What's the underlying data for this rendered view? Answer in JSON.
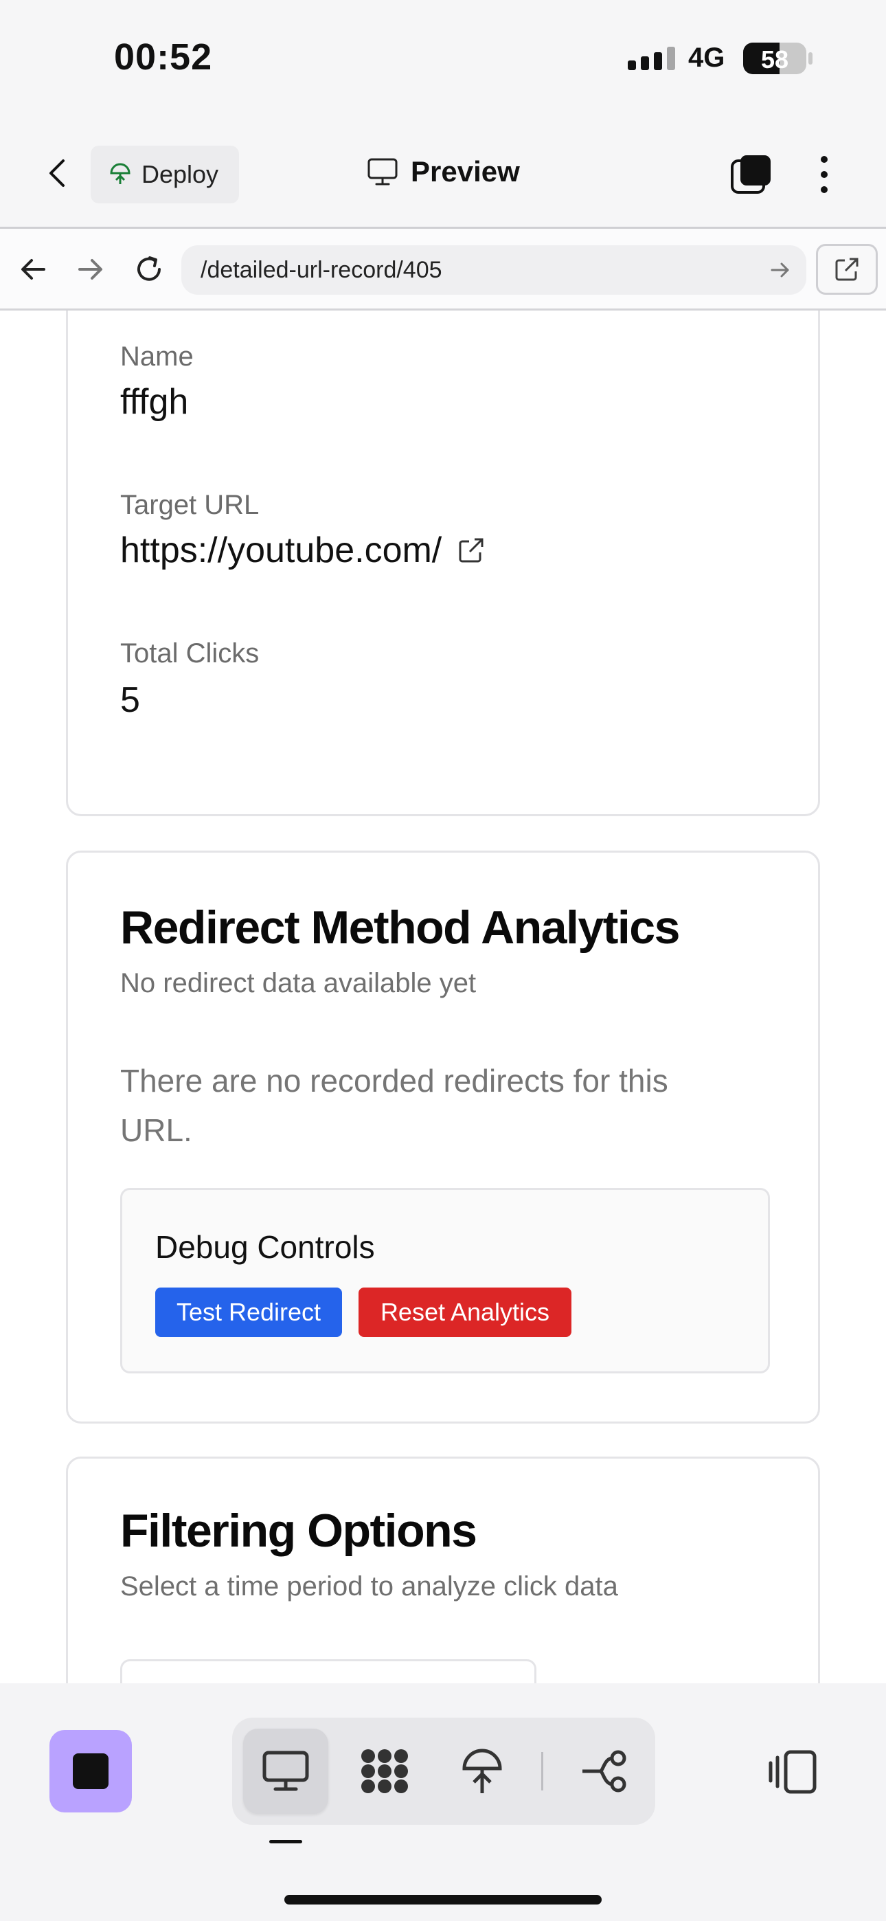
{
  "status_bar": {
    "time": "00:52",
    "network": "4G",
    "battery": "58",
    "battery_level": 0.58
  },
  "app_header": {
    "deploy_label": "Deploy",
    "preview_label": "Preview"
  },
  "browser": {
    "url": "/detailed-url-record/405"
  },
  "details_card": {
    "name_label": "Name",
    "name_value": "fffgh",
    "target_url_label": "Target URL",
    "target_url_value": "https://youtube.com/",
    "total_clicks_label": "Total Clicks",
    "total_clicks_value": "5"
  },
  "redirect_card": {
    "title": "Redirect Method Analytics",
    "subtitle": "No redirect data available yet",
    "empty_message": "There are no recorded redirects for this URL.",
    "debug": {
      "title": "Debug Controls",
      "test_button": "Test Redirect",
      "reset_button": "Reset Analytics"
    }
  },
  "filtering_card": {
    "title": "Filtering Options",
    "subtitle": "Select a time period to analyze click data"
  },
  "colors": {
    "accent_blue": "#2563eb",
    "danger_red": "#dc2626",
    "stop_button": "#b9a2ff"
  },
  "toolbar": {
    "icons": [
      "stop-icon",
      "desktop-icon",
      "apps-icon",
      "deploy-icon",
      "workflow-icon",
      "panel-icon"
    ]
  }
}
